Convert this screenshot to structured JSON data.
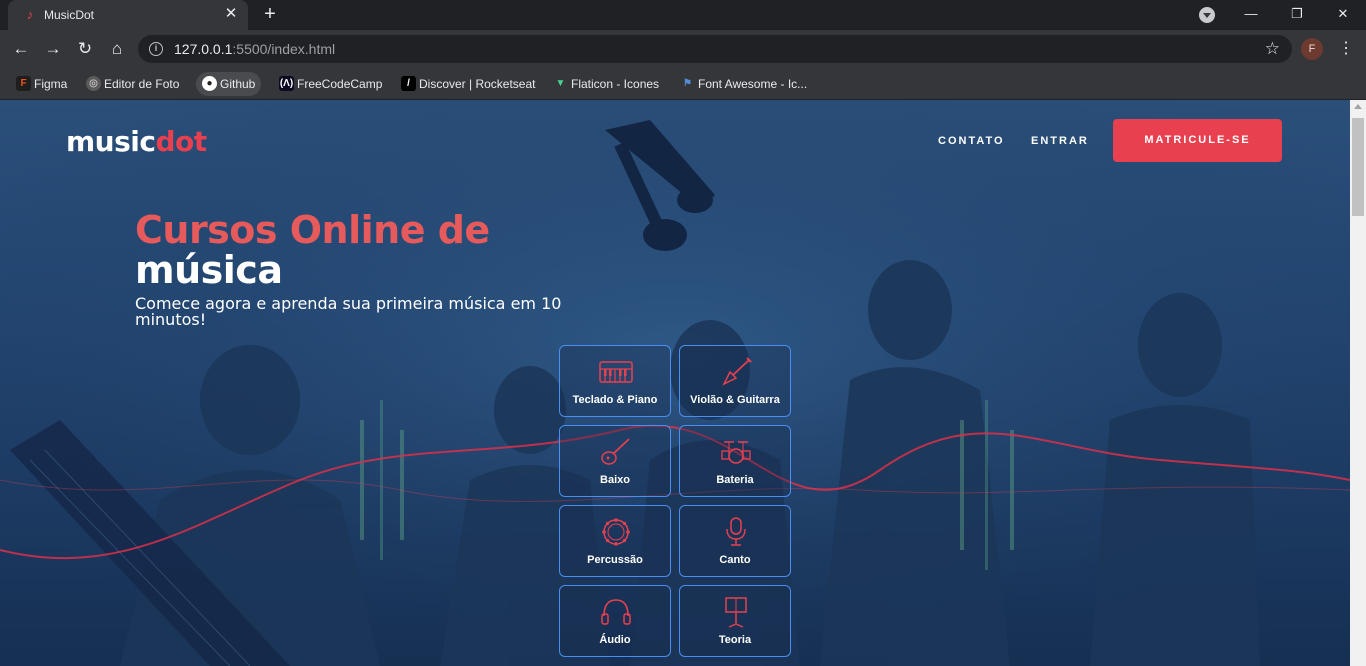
{
  "browser": {
    "tab_title": "MusicDot",
    "url_host": "127.0.0.1",
    "url_rest": ":5500/index.html",
    "profile_initial": "F",
    "bookmarks": [
      {
        "label": "Figma",
        "icon": "figma-icon"
      },
      {
        "label": "Editor de Foto",
        "icon": "photo-editor-icon"
      },
      {
        "label": "Github",
        "icon": "github-icon"
      },
      {
        "label": "FreeCodeCamp",
        "icon": "freecodecamp-icon"
      },
      {
        "label": "Discover | Rocketseat",
        "icon": "rocketseat-icon"
      },
      {
        "label": "Flaticon - Icones",
        "icon": "flaticon-icon"
      },
      {
        "label": "Font Awesome - Ic...",
        "icon": "fontawesome-icon"
      }
    ]
  },
  "page": {
    "logo": {
      "text_main": "music",
      "text_accent": "dot"
    },
    "nav": {
      "contato": "CONTATO",
      "entrar": "ENTRAR",
      "cta": "MATRICULE-SE"
    },
    "hero": {
      "title_line1": "Cursos Online de",
      "title_line2": "música",
      "subtitle": "Comece agora e aprenda sua primeira música em 10 minutos!"
    },
    "courses": [
      {
        "label": "Teclado & Piano",
        "icon": "keyboard-icon"
      },
      {
        "label": "Violão & Guitarra",
        "icon": "guitar-icon"
      },
      {
        "label": "Baixo",
        "icon": "bass-icon"
      },
      {
        "label": "Bateria",
        "icon": "drums-icon"
      },
      {
        "label": "Percussão",
        "icon": "tambourine-icon"
      },
      {
        "label": "Canto",
        "icon": "microphone-icon"
      },
      {
        "label": "Áudio",
        "icon": "headphones-icon"
      },
      {
        "label": "Teoria",
        "icon": "music-stand-icon"
      }
    ],
    "colors": {
      "accent": "#e8404f",
      "card_border": "#4a8ef0",
      "background": "#234672"
    }
  }
}
